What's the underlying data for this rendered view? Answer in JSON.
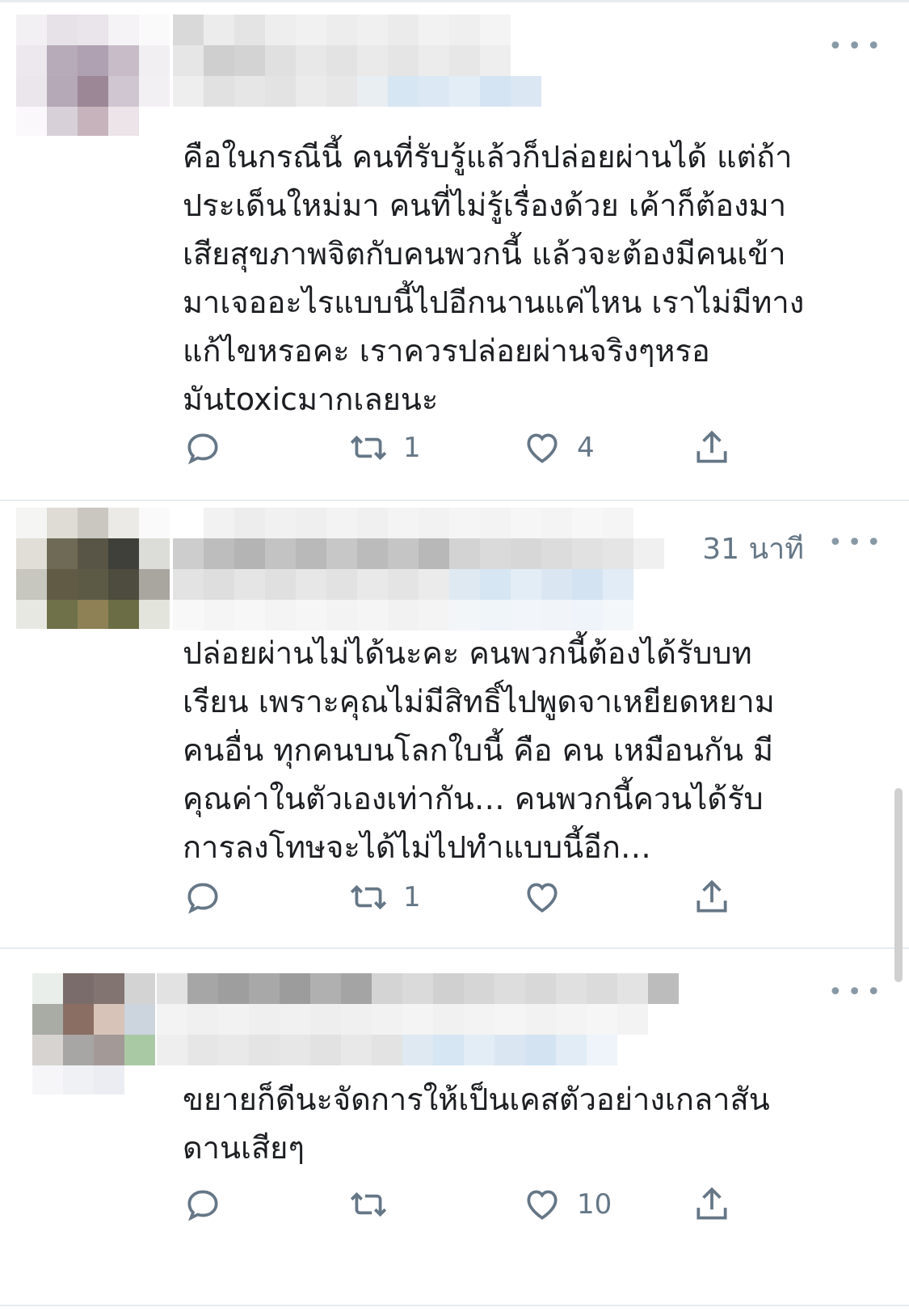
{
  "tweets": [
    {
      "text": "คือในกรณีนี้ คนที่รับรู้แล้วก็ปล่อยผ่านได้ แต่ถ้า\nประเด็นใหม่มา คนที่ไม่รู้เรื่องด้วย เค้าก็ต้องมา\nเสียสุขภาพจิตกับคนพวกนี้ แล้วจะต้องมีคนเข้า\nมาเจออะไรแบบนี้ไปอีกนานแค่ไหน เราไม่มีทาง\nแก้ไขหรอคะ เราควรปล่อยผ่านจริงๆหรอ\nมันtoxicมากเลยนะ",
      "retweets": "1",
      "likes": "4",
      "more_label": "•••"
    },
    {
      "time": "31 นาที",
      "text": "ปล่อยผ่านไม่ได้นะคะ คนพวกนี้ต้องได้รับบท\nเรียน เพราะคุณไม่มีสิทธิ์ไปพูดจาเหยียดหยาม\nคนอื่น ทุกคนบนโลกใบนี้ คือ คน เหมือนกัน มี\nคุณค่าในตัวเองเท่ากัน… คนพวกนี้ควนได้รับ\nการลงโทษจะได้ไม่ไปทำแบบนี้อีก…",
      "retweets": "1",
      "likes": "",
      "more_label": "•••"
    },
    {
      "text": "ขยายก็ดีนะจัดการให้เป็นเคสตัวอย่างเกลาสัน\nดานเสียๆ",
      "retweets": "",
      "likes": "10",
      "more_label": "•••"
    }
  ],
  "colors": {
    "icon": "#657786",
    "divider": "#e6ecf0",
    "handle_blur": "#d6e6f3"
  },
  "icons": [
    "reply-icon",
    "retweet-icon",
    "like-icon",
    "share-icon",
    "more-icon"
  ]
}
